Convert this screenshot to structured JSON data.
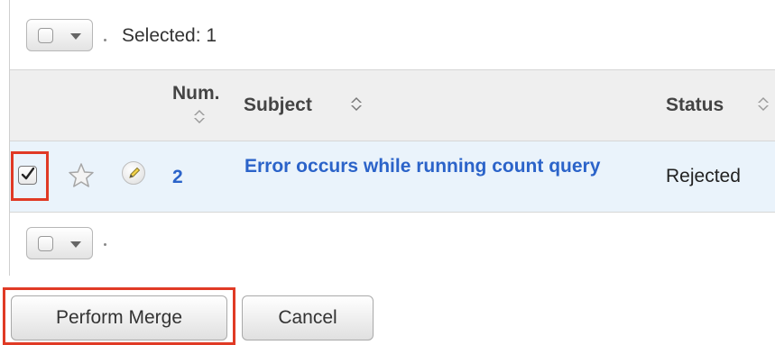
{
  "toolbar": {
    "selected_label": "Selected: 1"
  },
  "table": {
    "columns": [
      {
        "label_line1": "Num.",
        "key": "num"
      },
      {
        "label": "Subject",
        "key": "subject"
      },
      {
        "label": "Status",
        "key": "status"
      }
    ],
    "rows": [
      {
        "checked": true,
        "num": "2",
        "subject": "Error occurs while running count query",
        "status": "Rejected"
      }
    ]
  },
  "buttons": {
    "perform_merge": "Perform Merge",
    "cancel": "Cancel"
  },
  "colors": {
    "link": "#2b63c9",
    "highlight": "#e03a25",
    "row_selected_bg": "#eaf3fb",
    "header_bg": "#efefef"
  },
  "icons": [
    "select-all-checkbox-icon",
    "chevron-down-icon",
    "sort-icon",
    "checkbox-checked-icon",
    "star-icon",
    "edit-pencil-icon"
  ]
}
